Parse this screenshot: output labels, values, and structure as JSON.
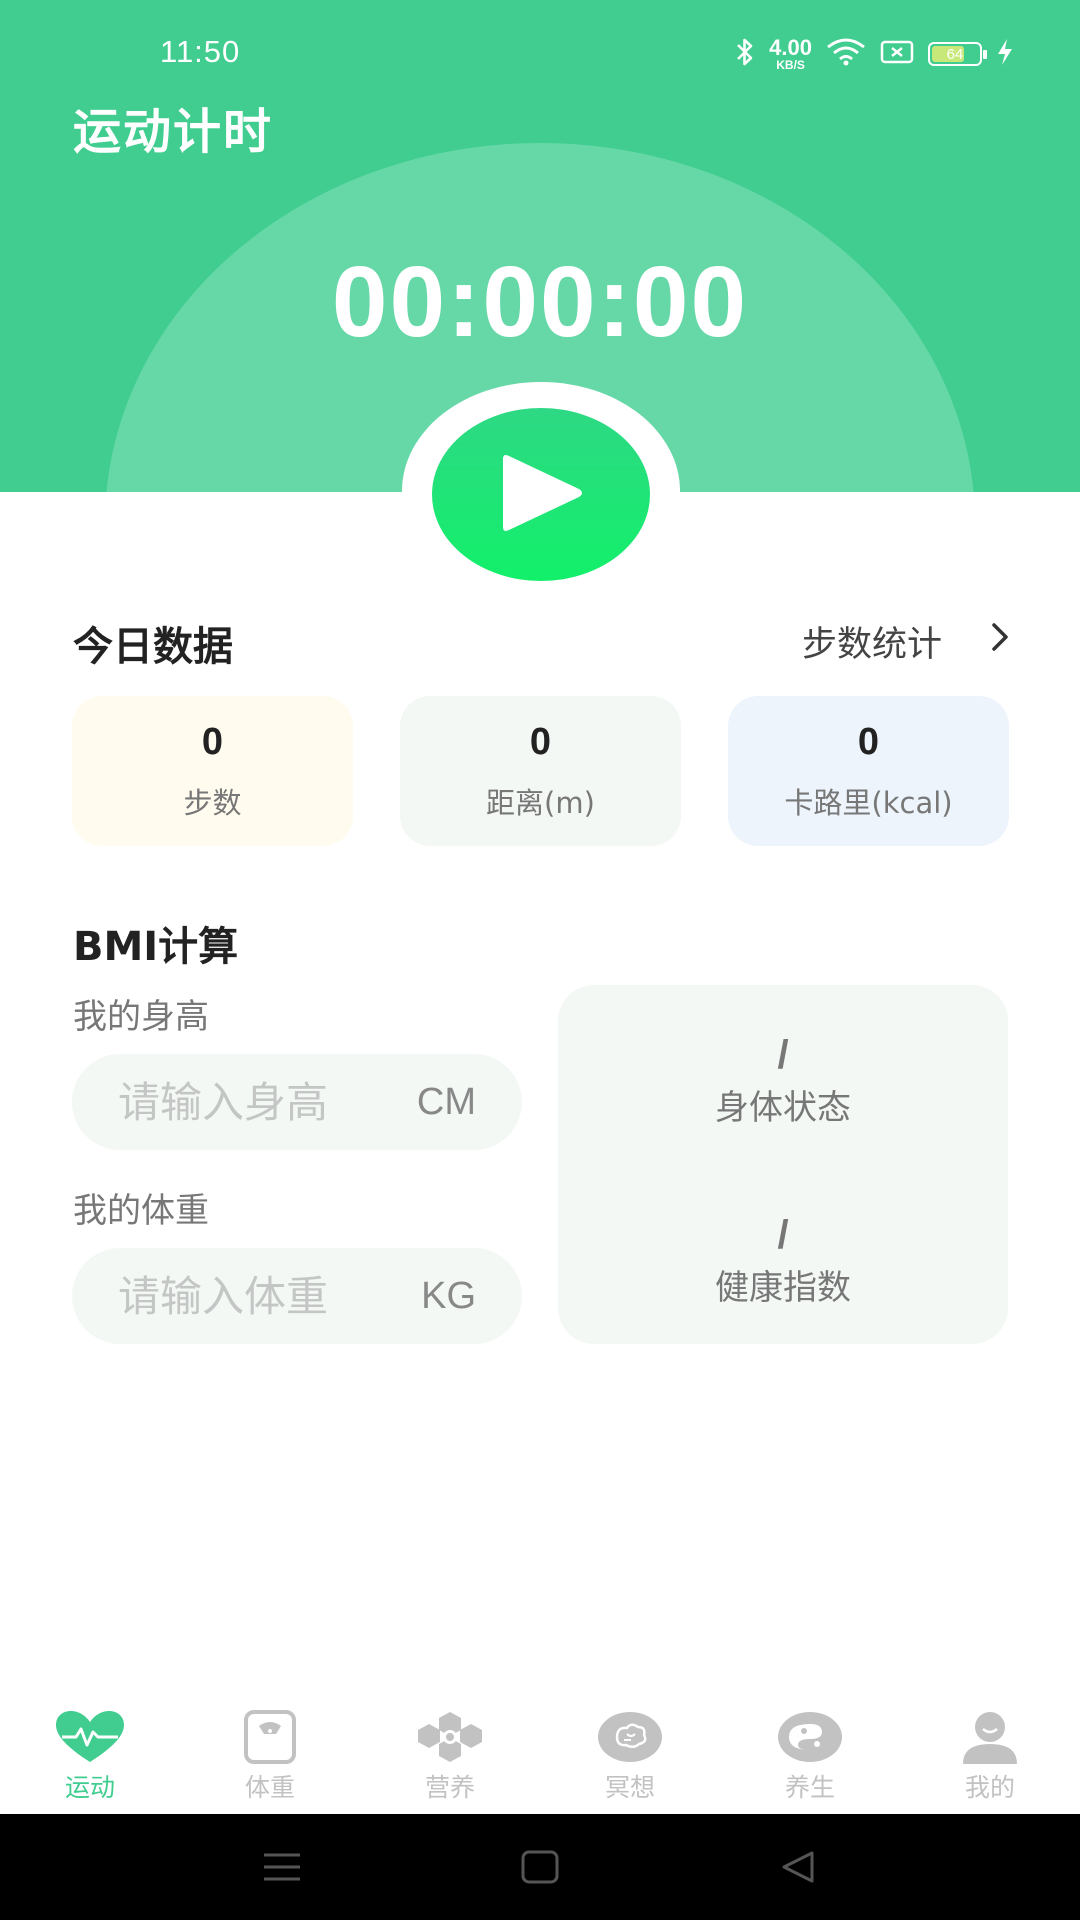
{
  "status_bar": {
    "time": "11:50",
    "net_speed": "4.00",
    "net_unit": "KB/S",
    "battery": "64"
  },
  "header": {
    "title": "运动计时",
    "timer": "00:00:00"
  },
  "today": {
    "title": "今日数据",
    "link_label": "步数统计",
    "cards": [
      {
        "value": "0",
        "label": "步数"
      },
      {
        "value": "0",
        "label": "距离(m)"
      },
      {
        "value": "0",
        "label": "卡路里(kcal)"
      }
    ]
  },
  "bmi": {
    "title": "BMI计算",
    "height_label": "我的身高",
    "height_placeholder": "请输入身高",
    "height_unit": "CM",
    "weight_label": "我的体重",
    "weight_placeholder": "请输入体重",
    "weight_unit": "KG",
    "body_status_value": "/",
    "body_status_label": "身体状态",
    "health_index_value": "/",
    "health_index_label": "健康指数"
  },
  "nav": [
    {
      "label": "运动",
      "icon": "heart-pulse-icon",
      "active": true
    },
    {
      "label": "体重",
      "icon": "scale-icon",
      "active": false
    },
    {
      "label": "营养",
      "icon": "hexagon-cluster-icon",
      "active": false
    },
    {
      "label": "冥想",
      "icon": "brain-icon",
      "active": false
    },
    {
      "label": "养生",
      "icon": "yin-yang-icon",
      "active": false
    },
    {
      "label": "我的",
      "icon": "person-icon",
      "active": false
    }
  ],
  "colors": {
    "primary": "#40cd8f",
    "arc": "#66d8a8",
    "play": "#12f06a",
    "inactive": "#c2c2c2"
  }
}
